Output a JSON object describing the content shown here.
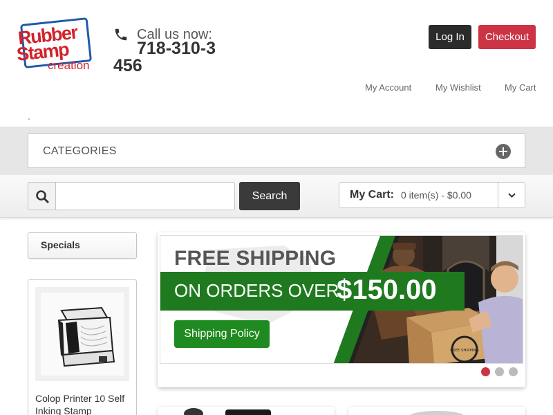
{
  "header": {
    "logo": {
      "line1": "Rubber",
      "line2": "Stamp",
      "line3": "creation"
    },
    "phone": {
      "label": "Call us now:",
      "number": "718-310-3456",
      "icon": "phone-icon"
    },
    "login_label": "Log In",
    "checkout_label": "Checkout",
    "links": [
      "My Account",
      "My Wishlist",
      "My Cart"
    ],
    "dash": "-"
  },
  "categories": {
    "label": "CATEGORIES",
    "icon": "plus-circle-icon"
  },
  "search": {
    "button_label": "Search",
    "placeholder": "",
    "value": "",
    "icon": "search-icon"
  },
  "cart": {
    "label": "My Cart:",
    "summary": "0 item(s) - $0.00",
    "icon": "chevron-down-icon"
  },
  "sidebar": {
    "specials_label": "Specials",
    "product": {
      "name": "Colop Printer 10 Self Inking Stamp"
    }
  },
  "banner": {
    "headline": "FREE SHIPPING",
    "subline": "ON ORDERS OVER",
    "amount": "$150.00",
    "button_label": "Shipping Policy",
    "box_stamp_text": "FREE SHIPPING",
    "slides": 3,
    "active_slide": 1
  },
  "colors": {
    "brand_red": "#d2232a",
    "brand_blue": "#1e5aa8",
    "checkout": "#cc3344",
    "dark_button": "#2b2b2b",
    "banner_green": "#1f7a1f",
    "dot_active": "#cc3344",
    "dot_inactive": "#bbbbbb"
  }
}
